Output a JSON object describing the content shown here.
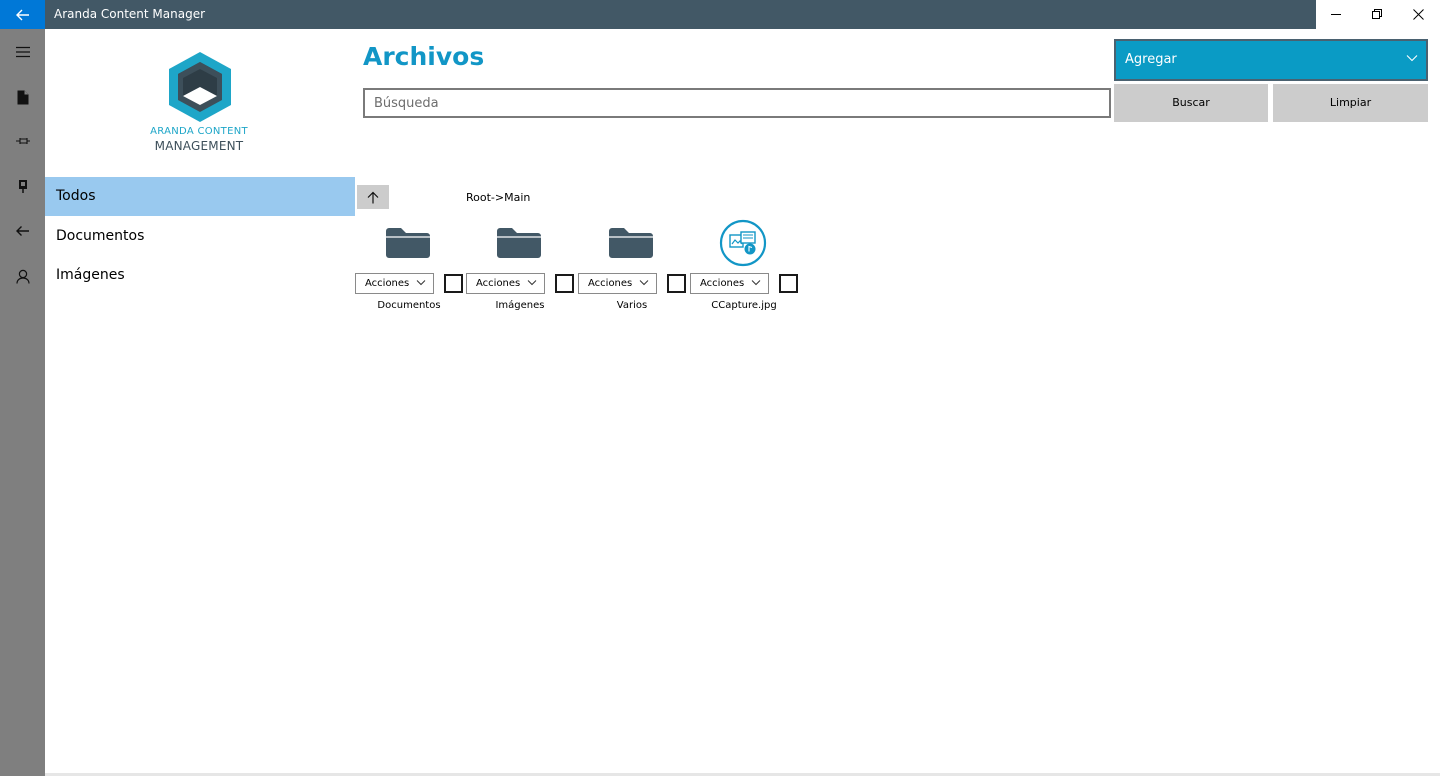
{
  "window": {
    "title": "Aranda Content Manager",
    "controls": [
      "minimize",
      "restore",
      "close"
    ]
  },
  "rail": {
    "items": [
      {
        "icon": "hamburger-menu-icon"
      },
      {
        "icon": "document-icon"
      },
      {
        "icon": "pin-icon"
      },
      {
        "icon": "usb-drive-icon"
      },
      {
        "icon": "back-arrow-icon"
      },
      {
        "icon": "user-icon"
      }
    ]
  },
  "logo": {
    "line1": "ARANDA CONTENT",
    "line2": "MANAGEMENT",
    "colors": {
      "primary": "#1ea6c8",
      "dark": "#3d4f5a"
    }
  },
  "nav": {
    "items": [
      {
        "label": "Todos",
        "selected": true
      },
      {
        "label": "Documentos",
        "selected": false
      },
      {
        "label": "Imágenes",
        "selected": false
      }
    ]
  },
  "header": {
    "title": "Archivos",
    "search_placeholder": "Búsqueda",
    "search_value": "",
    "add_select_value": "Agregar",
    "buscar_label": "Buscar",
    "limpiar_label": "Limpiar"
  },
  "content": {
    "breadcrumb": "Root->Main",
    "items": [
      {
        "name": "Documentos",
        "type": "folder",
        "actions_label": "Acciones",
        "checked": false
      },
      {
        "name": "Imágenes",
        "type": "folder",
        "actions_label": "Acciones",
        "checked": false
      },
      {
        "name": "Varios",
        "type": "folder",
        "actions_label": "Acciones",
        "checked": false
      },
      {
        "name": "CCapture.jpg",
        "type": "media-file",
        "actions_label": "Acciones",
        "checked": false
      }
    ]
  },
  "colors": {
    "titlebar": "#425866",
    "accent": "#0078d7",
    "rail": "#7f7f7f",
    "title_blue": "#1296c6",
    "select_bg": "#0a9bc5",
    "nav_selected": "#99c9ef",
    "folder": "#425866"
  }
}
